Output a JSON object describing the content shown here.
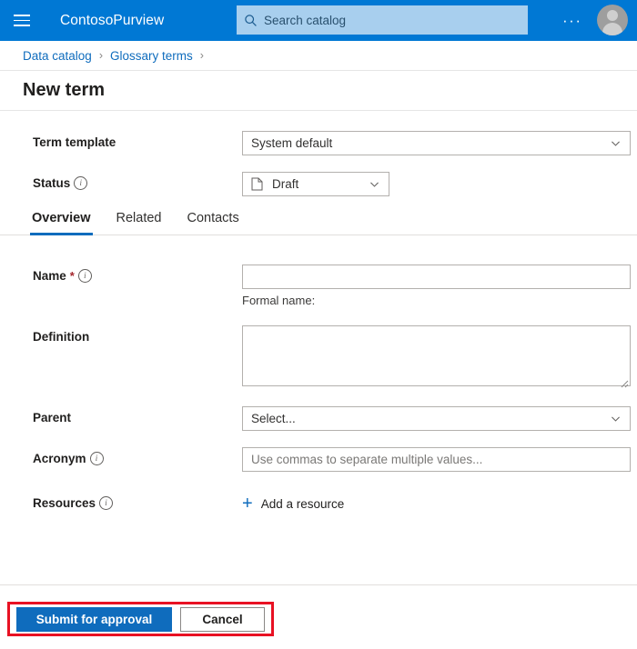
{
  "header": {
    "menu_icon": "hamburger-menu-icon",
    "brand": "ContosoPurview",
    "search": {
      "icon": "search-icon",
      "placeholder": "Search catalog",
      "value": ""
    },
    "more_label": "···",
    "avatar_icon": "user-avatar-icon",
    "accent_color": "#0078d4",
    "search_bg_color": "#a8cfee"
  },
  "breadcrumb": {
    "items": [
      {
        "label": "Data catalog"
      },
      {
        "label": "Glossary terms"
      }
    ],
    "separator": "›",
    "link_color": "#0f6cbd"
  },
  "page": {
    "title": "New term"
  },
  "form": {
    "term_template": {
      "label": "Term template",
      "value": "System default",
      "chevron_icon": "chevron-down-icon"
    },
    "status": {
      "label": "Status",
      "info_icon": "info-icon",
      "value": "Draft",
      "value_icon": "document-icon",
      "chevron_icon": "chevron-down-icon"
    },
    "name": {
      "label": "Name",
      "required_marker": "*",
      "info_icon": "info-icon",
      "value": "",
      "placeholder": "",
      "helper": "Formal name:"
    },
    "definition": {
      "label": "Definition",
      "value": "",
      "resize_icon": "resize-grip-icon"
    },
    "parent": {
      "label": "Parent",
      "value": "Select...",
      "chevron_icon": "chevron-down-icon"
    },
    "acronym": {
      "label": "Acronym",
      "info_icon": "info-icon",
      "value": "",
      "placeholder": "Use commas to separate multiple values..."
    },
    "resources": {
      "label": "Resources",
      "info_icon": "info-icon",
      "add_label": "Add a resource",
      "add_icon": "plus-icon"
    }
  },
  "tabs": {
    "items": [
      {
        "label": "Overview",
        "active": true
      },
      {
        "label": "Related",
        "active": false
      },
      {
        "label": "Contacts",
        "active": false
      }
    ],
    "active_underline_color": "#0f6cbd"
  },
  "footer": {
    "submit_label": "Submit for approval",
    "cancel_label": "Cancel",
    "primary_color": "#0f6cbd",
    "highlight_color": "#e81123"
  }
}
